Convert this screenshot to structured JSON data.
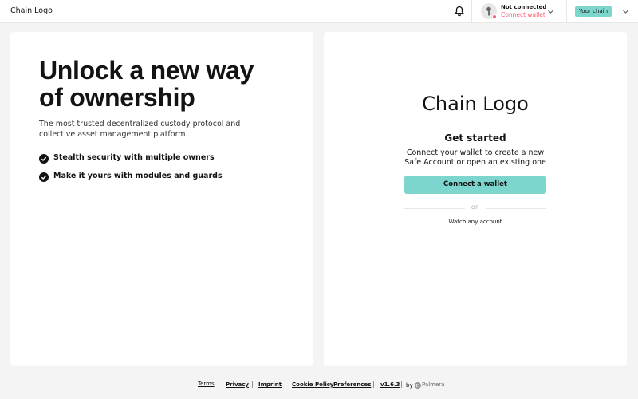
{
  "header": {
    "logo": "Chain Logo",
    "account_title": "Not connected",
    "account_subtitle": "Connect wallet",
    "chain_label": "Your chain",
    "icons": [
      "bell-icon",
      "key-icon",
      "chevron-down-icon"
    ],
    "colors": {
      "accent": "#7dd6ce",
      "error": "#ff5f72"
    }
  },
  "welcome": {
    "hero_line1": "Unlock a new way",
    "hero_line2": "of ownership",
    "description": "The most trusted decentralized custody protocol and collective asset management platform.",
    "features": [
      "Stealth security with multiple owners",
      "Make it yours with modules and guards"
    ]
  },
  "connect": {
    "brand": "Chain Logo",
    "title": "Get started",
    "description": "Connect your wallet to create a new Safe Account or open an existing one",
    "button": "Connect a wallet",
    "divider": "OR",
    "watch_link": "Watch any account"
  },
  "footer": {
    "links": [
      "Terms",
      "Privacy",
      "Imprint",
      "Cookie Policy",
      "Preferences",
      "v1.6.3"
    ],
    "cookie_joiner": "–",
    "by": "by",
    "brand": "Palmera"
  }
}
